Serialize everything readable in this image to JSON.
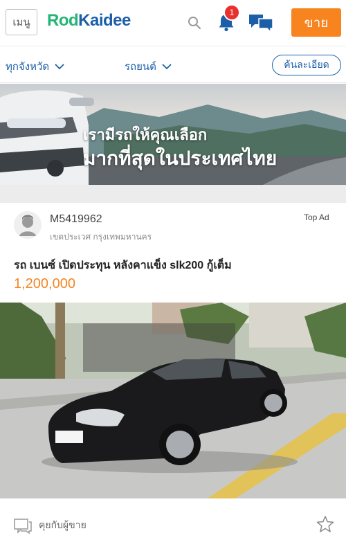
{
  "header": {
    "menu_label": "เมนู",
    "logo_part1": "Rod",
    "logo_part2": "Kaidee",
    "notification_count": "1",
    "sell_label": "ขาย"
  },
  "filters": {
    "province": "ทุกจังหวัด",
    "category": "รถยนต์",
    "detail_search": "ค้นละเอียด"
  },
  "banner": {
    "line1": "เรามีรถให้คุณเลือก",
    "line2": "มากที่สุดในประเทศไทย"
  },
  "listing": {
    "seller_name": "M5419962",
    "location": "เขตประเวศ กรุงเทพมหานคร",
    "top_ad_label": "Top Ad",
    "title": "รถ เบนซ์ เปิดประทุน หลังคาแข็ง slk200 กู้เต็ม",
    "price": "1,200,000",
    "chat_label": "คุยกับผู้ขาย"
  },
  "colors": {
    "brand_green": "#22b573",
    "brand_blue": "#1c5fa8",
    "accent_orange": "#f7841e",
    "badge_red": "#e8312f"
  },
  "icons": [
    "search-icon",
    "bell-icon",
    "chat-icon",
    "chevron-down-icon",
    "avatar-icon",
    "chat-seller-icon",
    "star-icon"
  ]
}
